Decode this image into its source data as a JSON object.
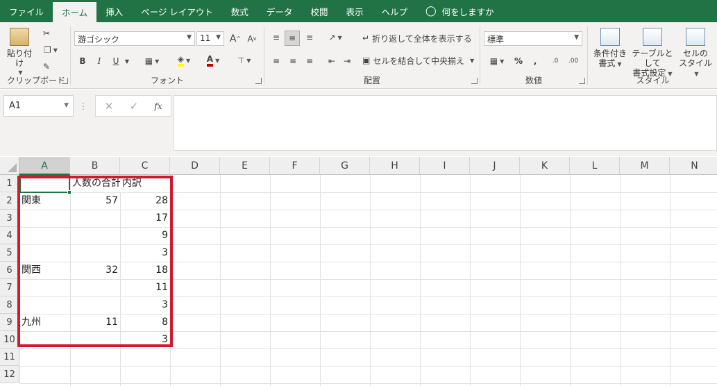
{
  "menu": {
    "tabs": [
      "ファイル",
      "ホーム",
      "挿入",
      "ページ レイアウト",
      "数式",
      "データ",
      "校閲",
      "表示",
      "ヘルプ"
    ],
    "active_tab": "ホーム",
    "tell_me": "何をしますか"
  },
  "ribbon": {
    "clipboard": {
      "paste_label": "貼り付け",
      "group_label": "クリップボード"
    },
    "font": {
      "font_name": "游ゴシック",
      "font_size": "11",
      "bold": "B",
      "italic": "I",
      "underline": "U",
      "group_label": "フォント"
    },
    "alignment": {
      "wrap_text": "折り返して全体を表示する",
      "merge_center": "セルを結合して中央揃え",
      "group_label": "配置"
    },
    "number": {
      "format": "標準",
      "group_label": "数値"
    },
    "styles": {
      "conditional": [
        "条件付き",
        "書式"
      ],
      "table": [
        "テーブルとして",
        "書式設定"
      ],
      "cell": [
        "セルの",
        "スタイル"
      ],
      "group_label": "スタイル"
    }
  },
  "formula_bar": {
    "name_box": "A1",
    "fx": "fx",
    "content": ""
  },
  "sheet": {
    "columns": [
      "A",
      "B",
      "C",
      "D",
      "E",
      "F",
      "G",
      "H",
      "I",
      "J",
      "K",
      "L",
      "M",
      "N"
    ],
    "selected_column": "A",
    "rows": [
      "1",
      "2",
      "3",
      "4",
      "5",
      "6",
      "7",
      "8",
      "9",
      "10",
      "11",
      "12"
    ],
    "cells": {
      "B1": "人数の合計",
      "C1": "内訳",
      "A2": "関東",
      "B2": "57",
      "C2": "28",
      "C3": "17",
      "C4": "9",
      "C5": "3",
      "A6": "関西",
      "B6": "32",
      "C6": "18",
      "C7": "11",
      "C8": "3",
      "A9": "九州",
      "B9": "11",
      "C9": "8",
      "C10": "3"
    }
  },
  "colors": {
    "accent": "#217346",
    "highlight_box": "#d0192f"
  }
}
